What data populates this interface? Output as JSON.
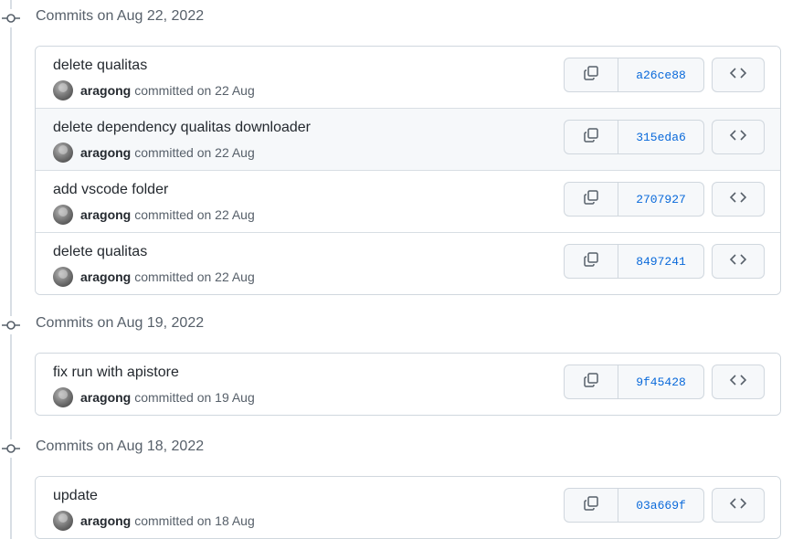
{
  "colors": {
    "accent_link": "#0969da",
    "muted_text": "#57606a",
    "border": "#d0d7de",
    "hover_row": "#f6f8fa"
  },
  "groups": [
    {
      "title": "Commits on Aug 22, 2022",
      "commits": [
        {
          "message": "delete qualitas",
          "author": "aragong",
          "committed": "committed on 22 Aug",
          "sha": "a26ce88"
        },
        {
          "message": "delete dependency qualitas downloader",
          "author": "aragong",
          "committed": "committed on 22 Aug",
          "sha": "315eda6"
        },
        {
          "message": "add vscode folder",
          "author": "aragong",
          "committed": "committed on 22 Aug",
          "sha": "2707927"
        },
        {
          "message": "delete qualitas",
          "author": "aragong",
          "committed": "committed on 22 Aug",
          "sha": "8497241"
        }
      ]
    },
    {
      "title": "Commits on Aug 19, 2022",
      "commits": [
        {
          "message": "fix run with apistore",
          "author": "aragong",
          "committed": "committed on 19 Aug",
          "sha": "9f45428"
        }
      ]
    },
    {
      "title": "Commits on Aug 18, 2022",
      "commits": [
        {
          "message": "update",
          "author": "aragong",
          "committed": "committed on 18 Aug",
          "sha": "03a669f"
        }
      ]
    }
  ],
  "icons": {
    "group_marker": "git-commit-icon",
    "copy": "copy-icon",
    "browse": "code-icon",
    "avatar": "user-avatar"
  }
}
